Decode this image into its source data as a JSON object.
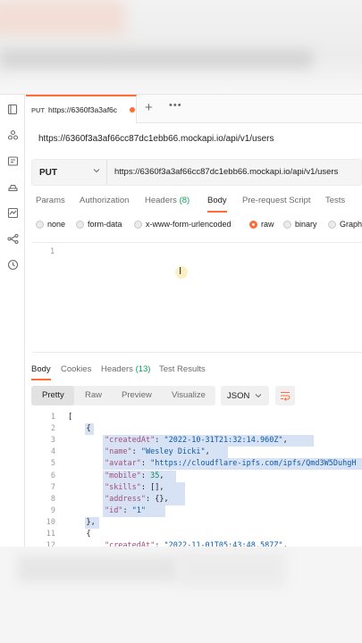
{
  "tab": {
    "method": "PUT",
    "url_short": "https://6360f3a3af6c",
    "new_tab_symbol": "+",
    "more_symbol": "•••"
  },
  "request": {
    "title": "https://6360f3a3af66cc87dc1ebb66.mockapi.io/api/v1/users",
    "method": "PUT",
    "url": "https://6360f3a3af66cc87dc1ebb66.mockapi.io/api/v1/users"
  },
  "request_tabs": {
    "params": "Params",
    "authorization": "Authorization",
    "headers": "Headers",
    "headers_count": "(8)",
    "body": "Body",
    "prerequest": "Pre-request Script",
    "tests": "Tests"
  },
  "body_options": {
    "none": "none",
    "form_data": "form-data",
    "urlencoded": "x-www-form-urlencoded",
    "raw": "raw",
    "binary": "binary",
    "graphql": "Graph"
  },
  "editor": {
    "line1": "1"
  },
  "response_tabs": {
    "body": "Body",
    "cookies": "Cookies",
    "headers": "Headers",
    "headers_count": "(13)",
    "test_results": "Test Results"
  },
  "format_bar": {
    "pretty": "Pretty",
    "raw": "Raw",
    "preview": "Preview",
    "visualize": "Visualize",
    "language": "JSON"
  },
  "response_lines": [
    {
      "n": "1",
      "t": "["
    },
    {
      "n": "2",
      "t": "    {"
    },
    {
      "n": "3",
      "key": "\"createdAt\"",
      "val": "\"2022-10-31T21:32:14.960Z\"",
      "vt": "s",
      "tail": ","
    },
    {
      "n": "4",
      "key": "\"name\"",
      "val": "\"Wesley Dicki\"",
      "vt": "s",
      "tail": ","
    },
    {
      "n": "5",
      "key": "\"avatar\"",
      "val": "\"https://cloudflare-ipfs.com/ipfs/Qmd3W5DuhgH",
      "vt": "s",
      "tail": ""
    },
    {
      "n": "6",
      "key": "\"mobile\"",
      "val": "35",
      "vt": "n",
      "tail": ","
    },
    {
      "n": "7",
      "key": "\"skills\"",
      "val": "[]",
      "vt": "p",
      "tail": ","
    },
    {
      "n": "8",
      "key": "\"address\"",
      "val": "{}",
      "vt": "p",
      "tail": ","
    },
    {
      "n": "9",
      "key": "\"id\"",
      "val": "\"1\"",
      "vt": "s",
      "tail": ""
    },
    {
      "n": "10",
      "t": "    },"
    },
    {
      "n": "11",
      "t": "    {"
    },
    {
      "n": "12",
      "key": "\"createdAt\"",
      "val": "\"2022-11-01T05:43:48.587Z\"",
      "vt": "s",
      "tail": ","
    }
  ],
  "colors": {
    "accent": "#ff6c37",
    "json_key": "#a0507a",
    "json_string": "#0f5aa6",
    "json_number": "#0f8f5a",
    "selection": "#d7e3f4"
  },
  "icons": [
    "collections-icon",
    "apis-icon",
    "environments-icon",
    "mock-servers-icon",
    "monitors-icon",
    "flows-icon",
    "history-icon",
    "chevron-down-icon",
    "text-wrap-icon",
    "text-cursor-icon"
  ]
}
